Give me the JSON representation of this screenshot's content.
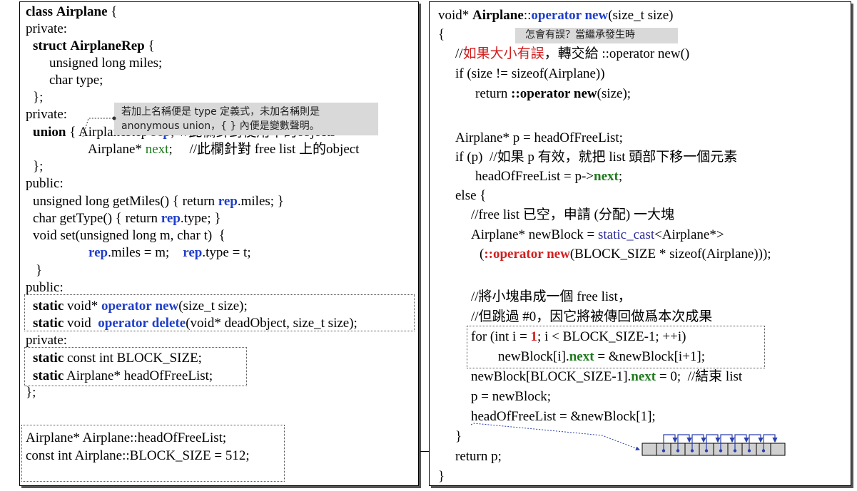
{
  "left": {
    "line1": {
      "kw": "class",
      "name": "Airplane",
      "rest": " {"
    },
    "line2": "private:",
    "line3": {
      "kw": "struct",
      "name": "AirplaneRep",
      "rest": " {"
    },
    "line4": "unsigned long miles;",
    "line5": "char type;",
    "line6": "};",
    "line7": "private:",
    "line8": {
      "kw": "union",
      "a": " { AirplaneRep ",
      "rep": "rep",
      "b": ";  //此欄針對使用中的objects"
    },
    "line9": {
      "a": "Airplane* ",
      "next": "next",
      "b": ";     //此欄針對 free list 上的object"
    },
    "line10": "};",
    "line11": "public:",
    "line12": {
      "a": "unsigned long getMiles() { return ",
      "rep": "rep",
      "b": ".miles; }"
    },
    "line13": {
      "a": "char getType() { return ",
      "rep": "rep",
      "b": ".type; }"
    },
    "line14": "void set(unsigned long m, char t)  {",
    "line15": {
      "rep1": "rep",
      "a": ".miles = m;    ",
      "rep2": "rep",
      "b": ".type = t;"
    },
    "line16": "}",
    "line17": "public:",
    "line18": {
      "kw": "static",
      "a": " void* ",
      "op": "operator",
      "sp": " ",
      "new": "new",
      "b": "(size_t size);"
    },
    "line19": {
      "kw": "static",
      "a": " void  ",
      "op": "operator",
      "sp": " ",
      "del": "delete",
      "b": "(void* deadObject, size_t size);"
    },
    "line20": "private:",
    "line21": {
      "kw": "static",
      "b": " const int BLOCK_SIZE;"
    },
    "line22": {
      "kw": "static",
      "b": " Airplane* headOfFreeList;"
    },
    "line23": "};",
    "line24": "Airplane* Airplane::headOfFreeList;",
    "line25": "const int Airplane::BLOCK_SIZE = 512;",
    "note1": "若加上名稱便是 type 定義式，未加名稱則是",
    "note2": "anonymous union，{ } 內便是變數聲明。"
  },
  "right": {
    "line1": {
      "a": "void* ",
      "cls": "Airplane",
      "sep": "::",
      "op": "operator new",
      "b": "(size_t size)"
    },
    "brace_open": "{",
    "note": "怎會有誤？當繼承發生時",
    "line3": {
      "a": "//",
      "red": "如果大小有誤",
      "b": "，轉交給 ::operator new()"
    },
    "line4": "if (size != sizeof(Airplane))",
    "line5": {
      "a": "return ",
      "op": "::operator new",
      "b": "(size);"
    },
    "line6": "Airplane* p = headOfFreeList;",
    "line7": "if (p)  //如果 p 有效，就把 list 頭部下移一個元素",
    "line8": {
      "a": "headOfFreeList = p->",
      "next": "next",
      "b": ";"
    },
    "line9": "else {",
    "line10": "//free list 已空，申請 (分配) 一大塊",
    "line11": {
      "a": "Airplane* newBlock = ",
      "cast": "static_cast",
      "b": "<Airplane*>"
    },
    "line12": {
      "a": "(",
      "op": "::operator new",
      "b": "(BLOCK_SIZE * sizeof(Airplane)));"
    },
    "line13": "//將小塊串成一個 free list，",
    "line14": "//但跳過 #0，因它將被傳回做爲本次成果",
    "line15": {
      "a": "for (int i = ",
      "one": "1",
      "b": "; i < BLOCK_SIZE-1; ++i)"
    },
    "line16": {
      "a": "newBlock[i].",
      "next": "next",
      "b": " = &newBlock[i+1];"
    },
    "line17": {
      "a": "newBlock[BLOCK_SIZE-1].",
      "next": "next",
      "b": " = 0;  //結束 list"
    },
    "line18": "p = newBlock;",
    "line19": "headOfFreeList = &newBlock[1];",
    "line20": "}",
    "line21": "return p;",
    "brace_close": "}"
  },
  "diagram": {
    "cell_count": 10
  },
  "colors": {
    "keyword_blue": "#1f3ec8",
    "member_green": "#1f7a1f",
    "comment_red": "#d21e1e",
    "note_gray": "#d9d9d9"
  }
}
